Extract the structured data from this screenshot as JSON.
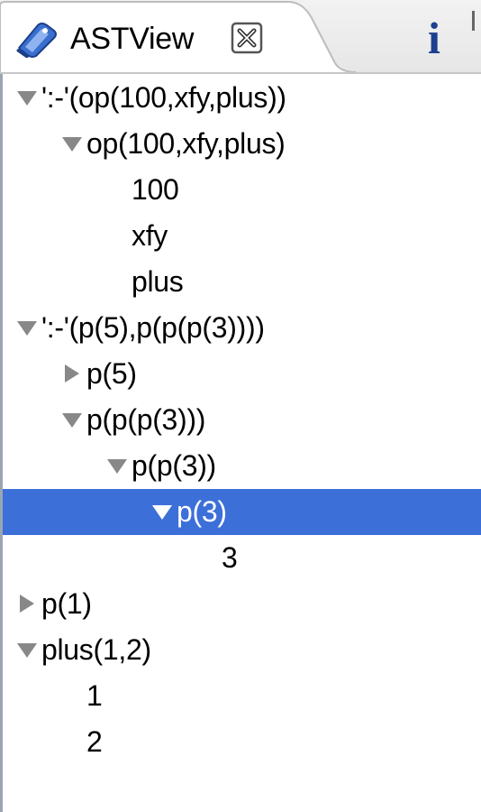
{
  "view": {
    "title": "ASTView",
    "info_glyph": "i"
  },
  "colors": {
    "selection": "#3c6fd8",
    "arrow": "#888888",
    "arrow_selected": "#ffffff"
  },
  "icons": {
    "tab_icon": "ast-view-icon",
    "close": "close-icon",
    "info": "info-icon",
    "expanded": "triangle-down-icon",
    "collapsed": "triangle-right-icon"
  },
  "tree": {
    "rows": [
      {
        "label": "':-'(op(100,xfy,plus))",
        "depth": 0,
        "state": "expanded",
        "selected": false
      },
      {
        "label": "op(100,xfy,plus)",
        "depth": 1,
        "state": "expanded",
        "selected": false
      },
      {
        "label": "100",
        "depth": 2,
        "state": "leaf",
        "selected": false
      },
      {
        "label": "xfy",
        "depth": 2,
        "state": "leaf",
        "selected": false
      },
      {
        "label": "plus",
        "depth": 2,
        "state": "leaf",
        "selected": false
      },
      {
        "label": "':-'(p(5),p(p(p(3))))",
        "depth": 0,
        "state": "expanded",
        "selected": false
      },
      {
        "label": "p(5)",
        "depth": 1,
        "state": "collapsed",
        "selected": false
      },
      {
        "label": "p(p(p(3)))",
        "depth": 1,
        "state": "expanded",
        "selected": false
      },
      {
        "label": "p(p(3))",
        "depth": 2,
        "state": "expanded",
        "selected": false
      },
      {
        "label": "p(3)",
        "depth": 3,
        "state": "expanded",
        "selected": true
      },
      {
        "label": "3",
        "depth": 4,
        "state": "leaf",
        "selected": false
      },
      {
        "label": "p(1)",
        "depth": 0,
        "state": "collapsed",
        "selected": false
      },
      {
        "label": "plus(1,2)",
        "depth": 0,
        "state": "expanded",
        "selected": false
      },
      {
        "label": "1",
        "depth": 1,
        "state": "leaf",
        "selected": false
      },
      {
        "label": "2",
        "depth": 1,
        "state": "leaf",
        "selected": false
      }
    ]
  }
}
